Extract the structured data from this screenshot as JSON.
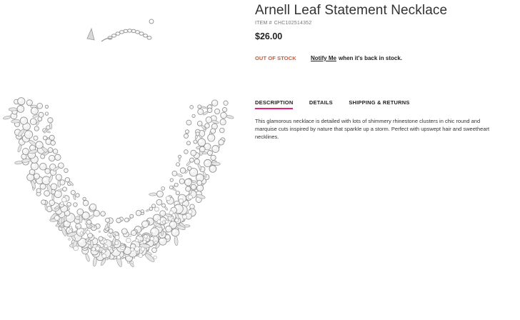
{
  "product": {
    "title": "Arnell Leaf Statement Necklace",
    "item_prefix": "ITEM #",
    "item_number": "CHC102514352",
    "price": "$26.00",
    "stock_status": "OUT OF STOCK",
    "notify_link": "Notify Me",
    "notify_rest": "when it's back in stock.",
    "image_icon": "rhinestone-necklace-image"
  },
  "tabs": [
    {
      "label": "DESCRIPTION",
      "active": true
    },
    {
      "label": "DETAILS",
      "active": false
    },
    {
      "label": "SHIPPING & RETURNS",
      "active": false
    }
  ],
  "description": "This glamorous necklace is detailed with lots of shimmery rhinestone clusters in chic round and marquise cuts inspired by nature that sparkle up a storm. Perfect with upswept hair and sweetheart necklines.",
  "colors": {
    "accent_underline": "#e81e86",
    "out_of_stock": "#e2552a"
  }
}
